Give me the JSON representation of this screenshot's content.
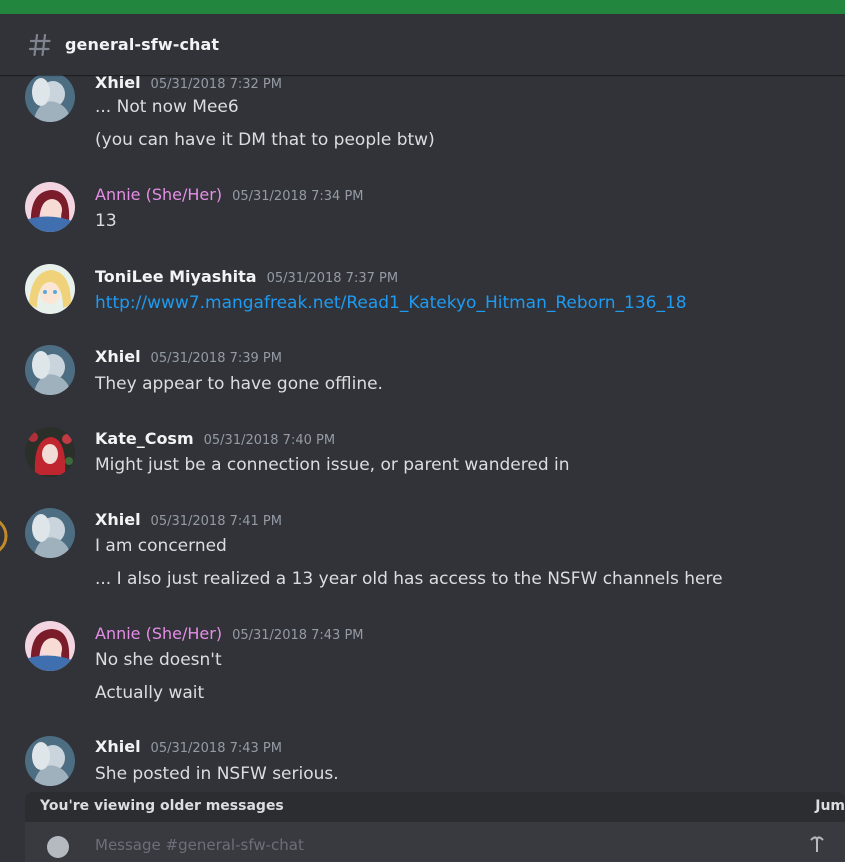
{
  "channel": {
    "name": "general-sfw-chat"
  },
  "messages": [
    {
      "author": "Xhiel",
      "timestamp": "05/31/2018 7:32 PM",
      "lines": [
        "... Not now Mee6",
        "(you can have it DM that to people btw)"
      ]
    },
    {
      "author": "Annie (She/Her)",
      "timestamp": "05/31/2018 7:34 PM",
      "lines": [
        "13"
      ]
    },
    {
      "author": "ToniLee Miyashita",
      "timestamp": "05/31/2018 7:37 PM",
      "lines": [
        "http://www7.mangafreak.net/Read1_Katekyo_Hitman_Reborn_136_18"
      ]
    },
    {
      "author": "Xhiel",
      "timestamp": "05/31/2018 7:39 PM",
      "lines": [
        "They appear to have gone offline."
      ]
    },
    {
      "author": "Kate_Cosm",
      "timestamp": "05/31/2018 7:40 PM",
      "lines": [
        "Might just be a connection issue, or parent wandered in"
      ]
    },
    {
      "author": "Xhiel",
      "timestamp": "05/31/2018 7:41 PM",
      "lines": [
        "I am concerned",
        "... I also just realized a 13 year old has access to the NSFW channels here"
      ]
    },
    {
      "author": "Annie (She/Her)",
      "timestamp": "05/31/2018 7:43 PM",
      "lines": [
        "No she doesn't",
        "Actually wait"
      ]
    },
    {
      "author": "Xhiel",
      "timestamp": "05/31/2018 7:43 PM",
      "lines": [
        "She posted in NSFW serious."
      ]
    }
  ],
  "banner": {
    "older_label": "You're viewing older messages",
    "jump_label": "Jum"
  },
  "composer": {
    "placeholder": "Message #general-sfw-chat"
  },
  "colors": {
    "role_pink": "#e58ee6",
    "link_blue": "#1e9bf3",
    "background": "#313338",
    "top_strip": "#23863f"
  },
  "icons": {
    "channel": "hash-icon",
    "attach": "plus-circle-icon",
    "gift": "gift-icon"
  }
}
